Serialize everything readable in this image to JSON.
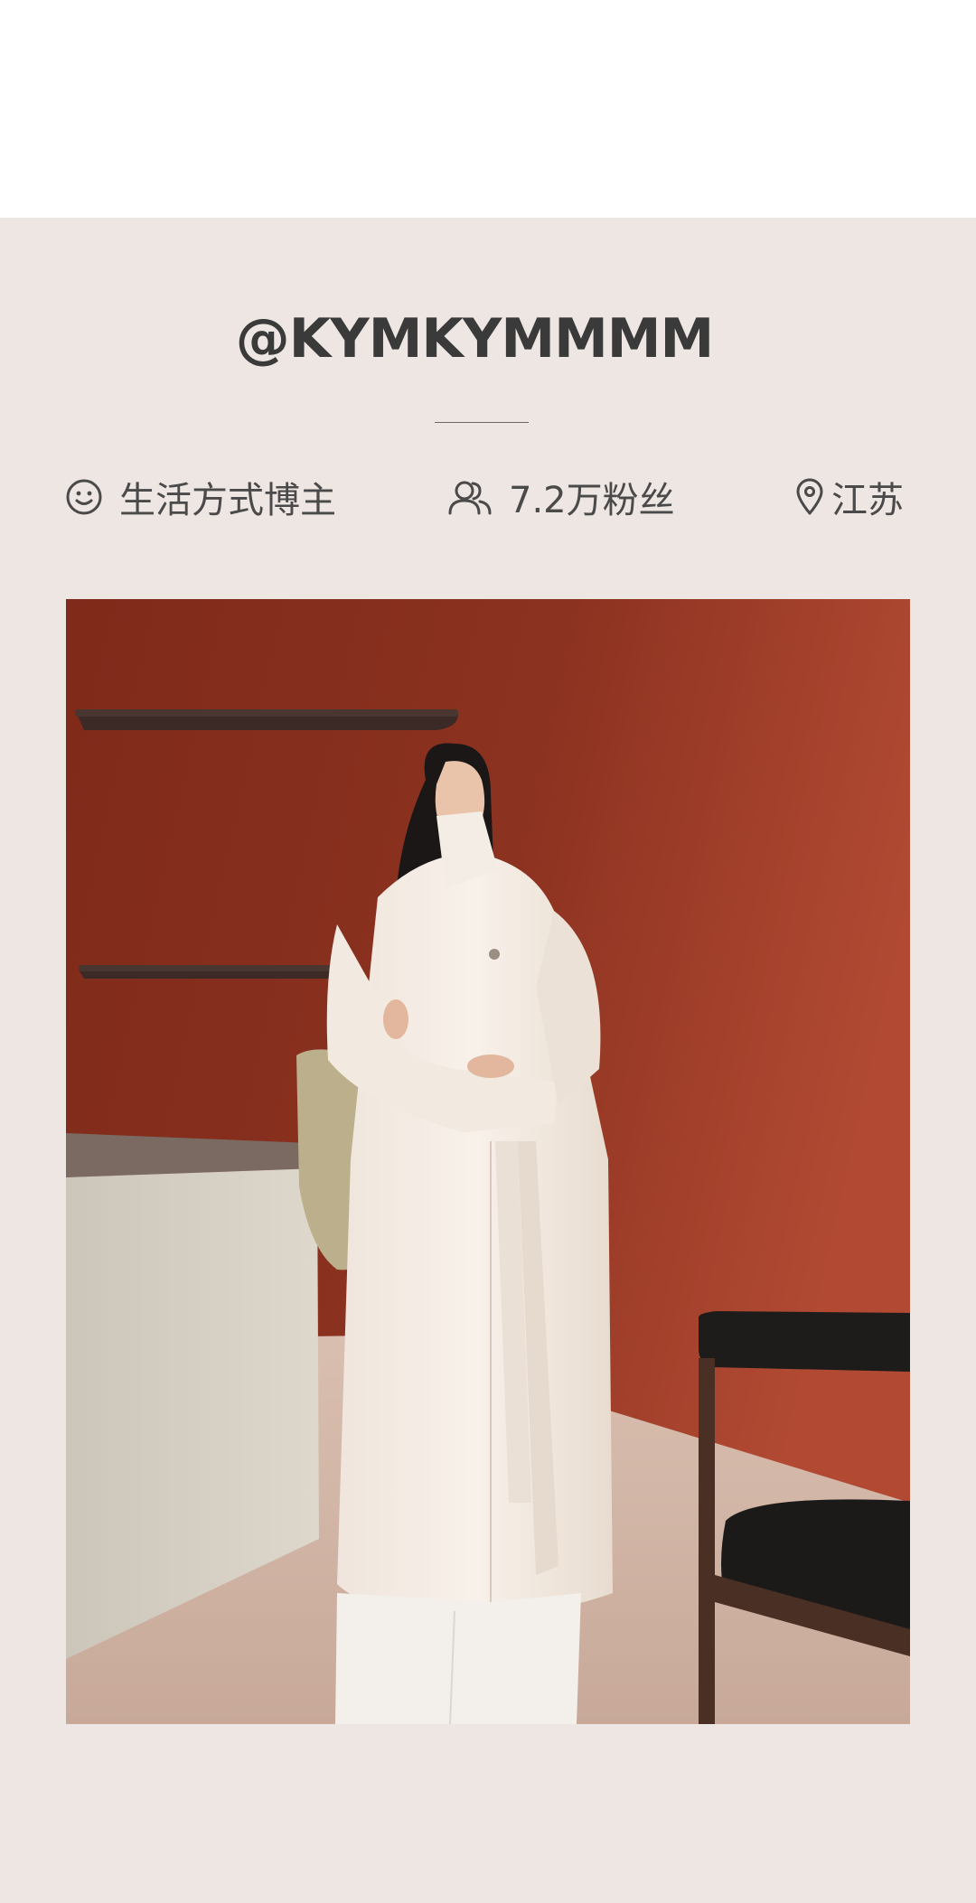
{
  "profile": {
    "handle": "@KYMKYMMMM",
    "category": "生活方式博主",
    "followers": "7.2万粉丝",
    "location": "江苏"
  },
  "icons": {
    "category": "smiley-icon",
    "followers": "users-icon",
    "location": "map-pin-icon"
  },
  "colors": {
    "card_background": "#eee6e3",
    "text": "#4a4a4a",
    "photo_wall": "#8e3320"
  }
}
